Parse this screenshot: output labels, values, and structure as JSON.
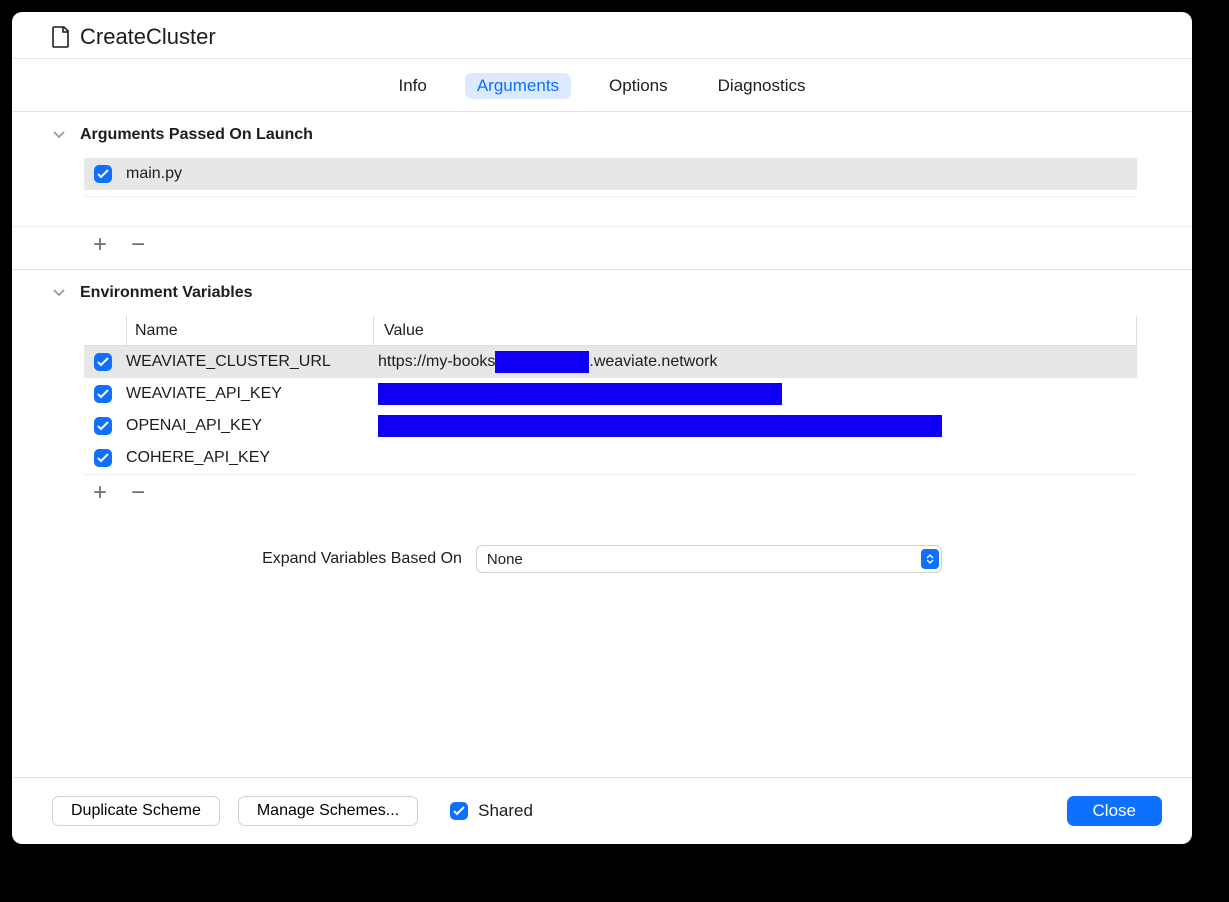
{
  "header": {
    "title": "CreateCluster"
  },
  "tabs": {
    "items": [
      {
        "label": "Info"
      },
      {
        "label": "Arguments"
      },
      {
        "label": "Options"
      },
      {
        "label": "Diagnostics"
      }
    ],
    "active_index": 1
  },
  "sections": {
    "arguments": {
      "title": "Arguments Passed On Launch",
      "rows": [
        {
          "checked": true,
          "text": "main.py",
          "selected": true
        }
      ]
    },
    "env": {
      "title": "Environment Variables",
      "columns": {
        "name": "Name",
        "value": "Value"
      },
      "rows": [
        {
          "checked": true,
          "name": "WEAVIATE_CLUSTER_URL",
          "value_prefix": "https://my-books",
          "value_suffix": ".weaviate.network",
          "redact_width": 94,
          "selected": true
        },
        {
          "checked": true,
          "name": "WEAVIATE_API_KEY",
          "value_prefix": "",
          "value_suffix": "",
          "redact_width": 404,
          "selected": false
        },
        {
          "checked": true,
          "name": "OPENAI_API_KEY",
          "value_prefix": "",
          "value_suffix": "",
          "redact_width": 564,
          "selected": false
        },
        {
          "checked": true,
          "name": "COHERE_API_KEY",
          "value_prefix": "",
          "value_suffix": "",
          "redact_width": 0,
          "selected": false
        }
      ]
    }
  },
  "expand": {
    "label": "Expand Variables Based On",
    "value": "None"
  },
  "footer": {
    "duplicate": "Duplicate Scheme",
    "manage": "Manage Schemes...",
    "shared_checked": true,
    "shared_label": "Shared",
    "close": "Close"
  }
}
